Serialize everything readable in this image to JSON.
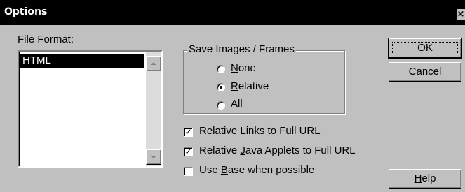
{
  "window": {
    "title": "Options",
    "close_glyph": "×"
  },
  "file_format": {
    "label": "File Format:",
    "items": [
      "HTML"
    ],
    "selected": "HTML"
  },
  "save_images": {
    "group_label": "Save Images / Frames",
    "options": [
      {
        "label_pre": "",
        "accel": "N",
        "label_post": "one",
        "checked": false
      },
      {
        "label_pre": "",
        "accel": "R",
        "label_post": "elative",
        "checked": true
      },
      {
        "label_pre": "",
        "accel": "A",
        "label_post": "ll",
        "checked": false
      }
    ]
  },
  "checkboxes": [
    {
      "label_pre": "Relative Links to ",
      "accel": "F",
      "label_post": "ull URL",
      "checked": true
    },
    {
      "label_pre": "Relative ",
      "accel": "J",
      "label_post": "ava Applets to Full URL",
      "checked": true
    },
    {
      "label_pre": "Use ",
      "accel": "B",
      "label_post": "ase when possible",
      "checked": false
    }
  ],
  "buttons": {
    "ok": "OK",
    "cancel": "Cancel",
    "help_accel": "H",
    "help_post": "elp"
  },
  "check_glyph": "✓"
}
